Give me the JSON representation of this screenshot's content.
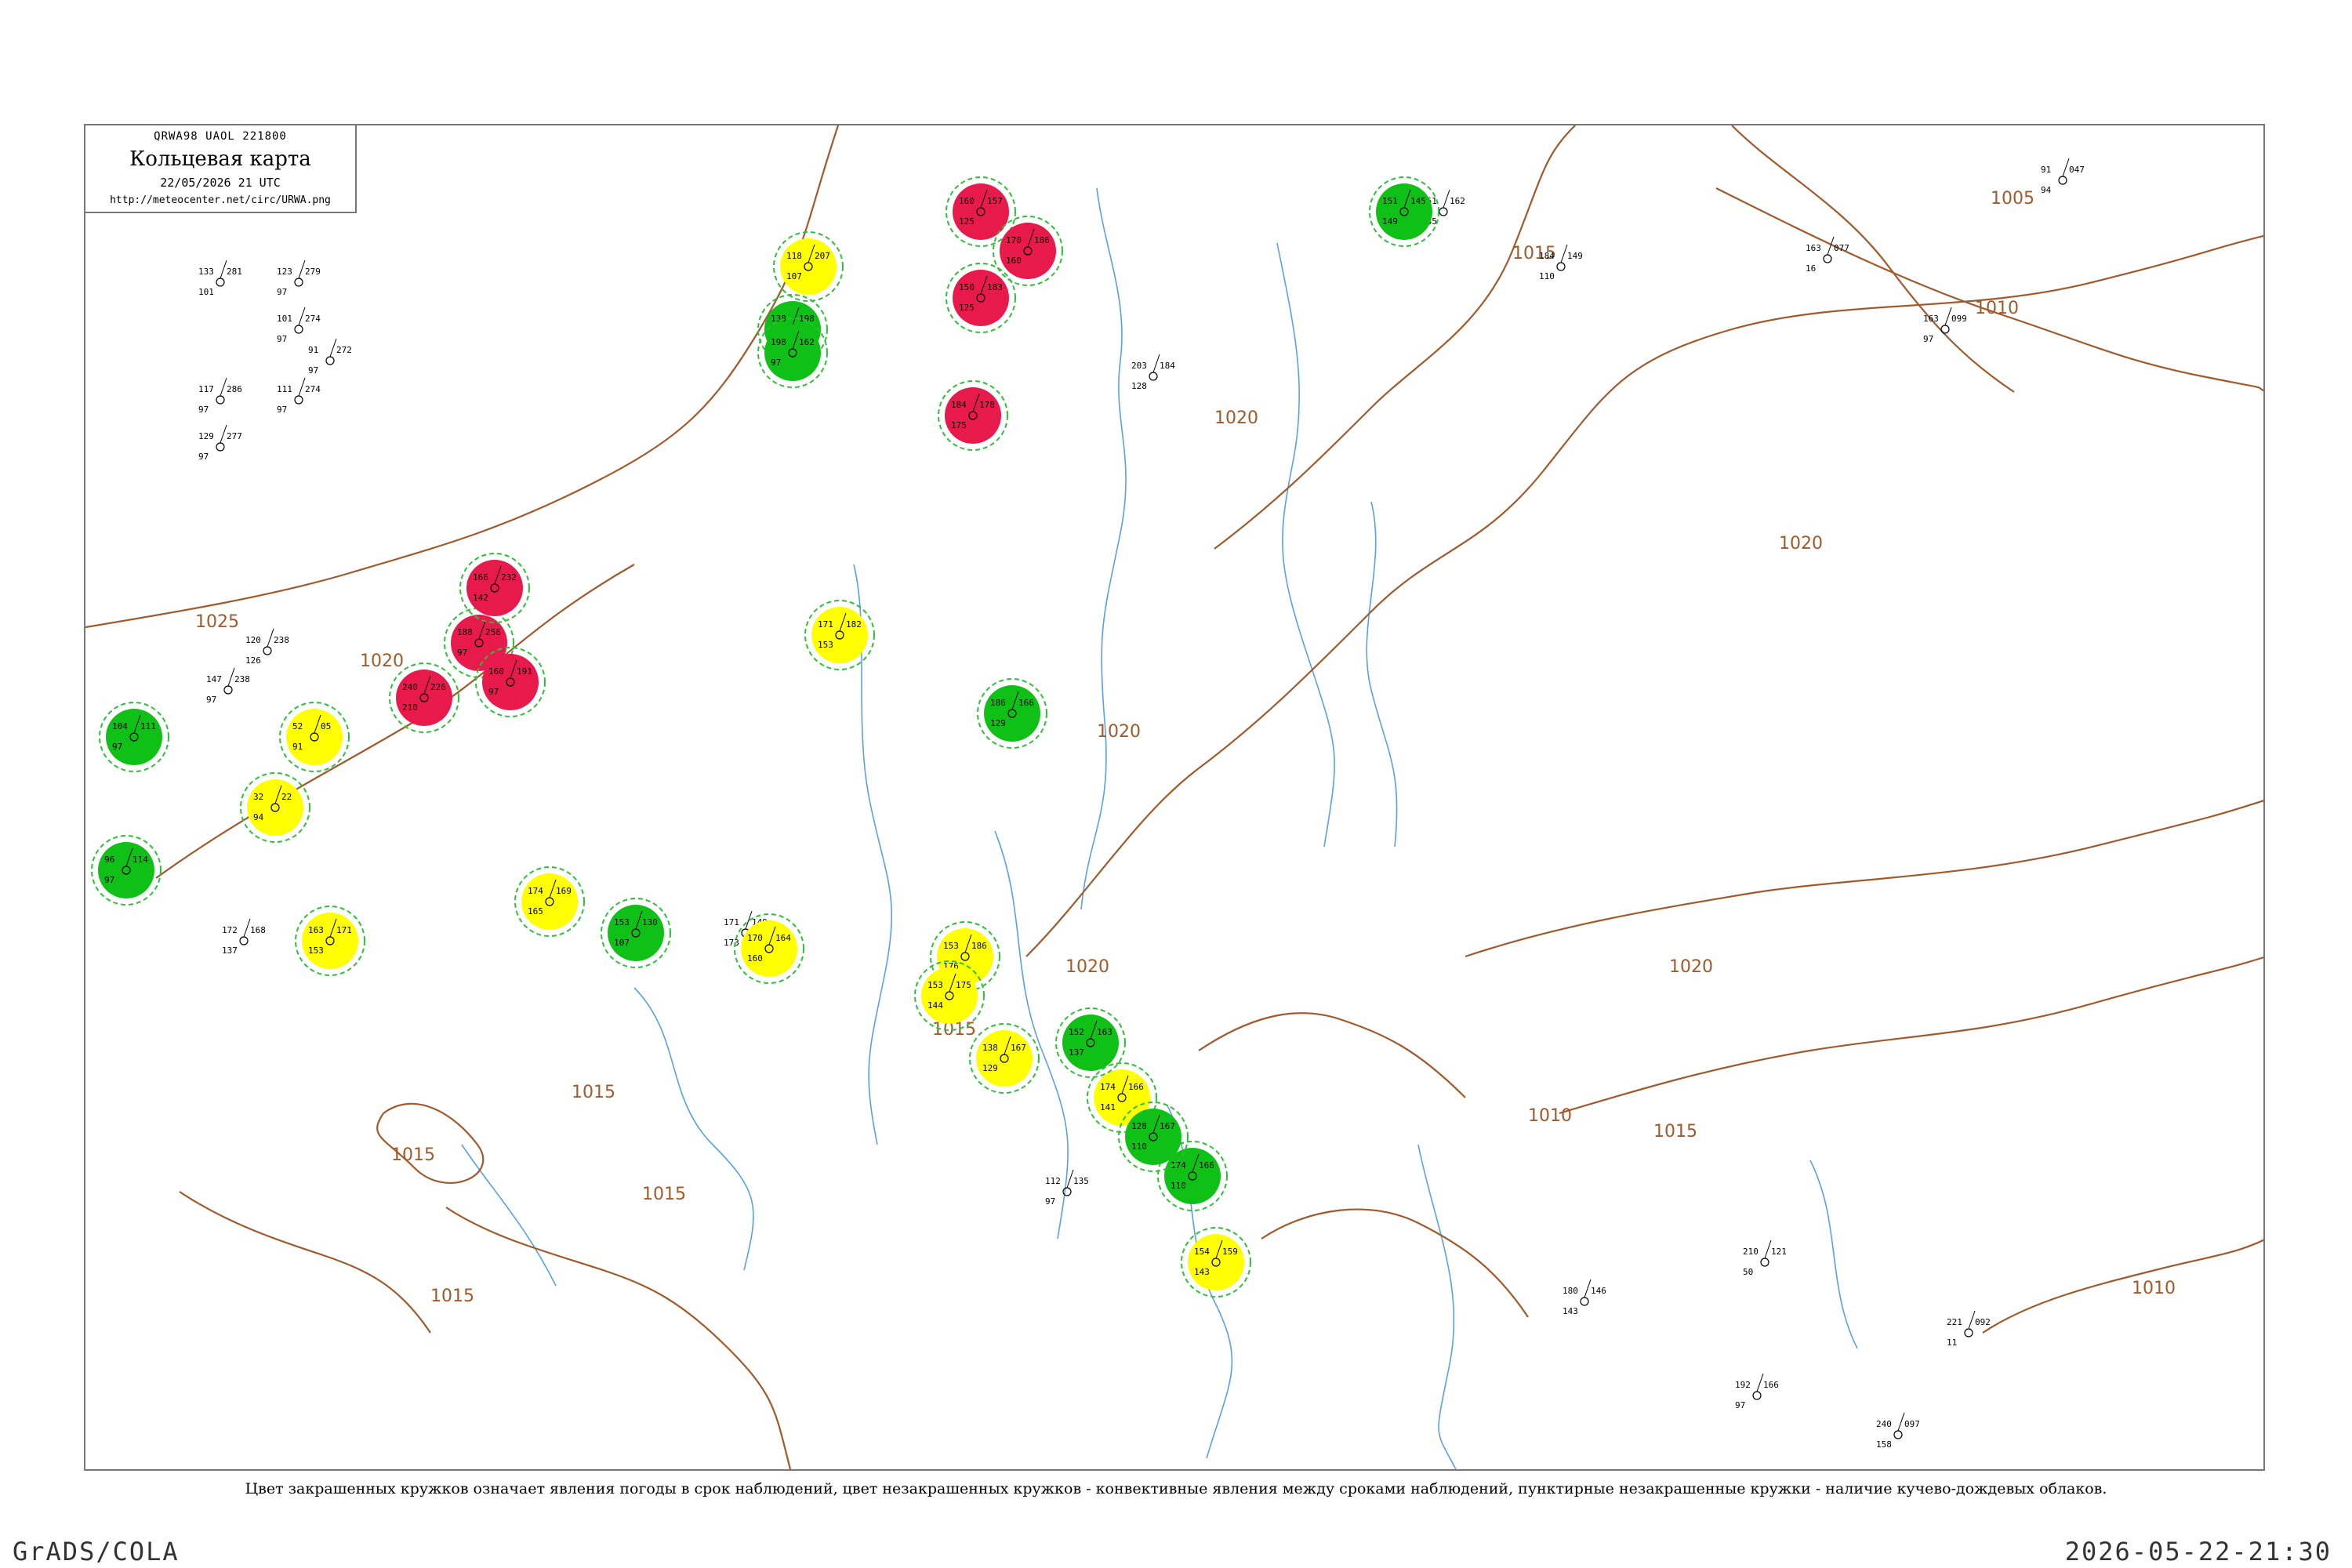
{
  "header": {
    "code": "QRWA98  UAOL  221800",
    "title": "Кольцевая карта",
    "datetime": "22/05/2026 21 UTC",
    "url": "http://meteocenter.net/circ/URWA.png"
  },
  "caption": "Цвет закрашенных кружков означает явления погоды в срок наблюдений, цвет незакрашенных кружков - конвективные явления между сроками наблюдений, пунктирные незакрашенные кружки - наличие кучево-дождевых облаков.",
  "footer": {
    "left": "GrADS/COLA",
    "right": "2026-05-22-21:30"
  },
  "colors": {
    "thunder": "#e8194b",
    "rain": "#0fc016",
    "fog": "#ffff00",
    "isobar": "#a05a2c",
    "river": "#5aa0e6",
    "cb_dashed": "#2fbf3a"
  },
  "isobar_labels": [
    "1025",
    "1020",
    "1015",
    "1015",
    "1015",
    "1015",
    "1015",
    "1020",
    "1020",
    "1020",
    "1015",
    "1010",
    "1005",
    "1010",
    "1020",
    "1020",
    "1015",
    "1010"
  ],
  "stations": [
    {
      "id": "s1",
      "pressure": "133",
      "temp": "281",
      "dew": "101",
      "marker": "none"
    },
    {
      "id": "s2",
      "pressure": "123",
      "temp": "279",
      "dew": "97",
      "marker": "none"
    },
    {
      "id": "s3",
      "pressure": "101",
      "temp": "274",
      "dew": "97",
      "marker": "none"
    },
    {
      "id": "s4",
      "pressure": "91",
      "temp": "272",
      "dew": "97",
      "marker": "none"
    },
    {
      "id": "s5",
      "pressure": "117",
      "temp": "286",
      "dew": "97",
      "marker": "none"
    },
    {
      "id": "s6",
      "pressure": "111",
      "temp": "274",
      "dew": "97",
      "marker": "none"
    },
    {
      "id": "s7",
      "pressure": "129",
      "temp": "277",
      "dew": "97",
      "marker": "none"
    },
    {
      "id": "s8",
      "pressure": "120",
      "temp": "238",
      "dew": "126",
      "marker": "none"
    },
    {
      "id": "s9",
      "pressure": "147",
      "temp": "238",
      "dew": "97",
      "marker": "none"
    },
    {
      "id": "s10",
      "pressure": "240",
      "temp": "226",
      "dew": "210",
      "marker": "thunder"
    },
    {
      "id": "s11",
      "pressure": "52",
      "temp": "05",
      "dew": "91",
      "marker": "fog"
    },
    {
      "id": "s12",
      "pressure": "32",
      "temp": "22",
      "dew": "94",
      "marker": "fog"
    },
    {
      "id": "s13",
      "pressure": "188",
      "temp": "256",
      "dew": "97",
      "marker": "thunder"
    },
    {
      "id": "s14",
      "pressure": "166",
      "temp": "232",
      "dew": "142",
      "marker": "thunder"
    },
    {
      "id": "s15",
      "pressure": "160",
      "temp": "191",
      "dew": "97",
      "marker": "thunder"
    },
    {
      "id": "s16",
      "pressure": "104",
      "temp": "111",
      "dew": "97",
      "marker": "rain"
    },
    {
      "id": "s17",
      "pressure": "96",
      "temp": "114",
      "dew": "97",
      "marker": "rain"
    },
    {
      "id": "s18",
      "pressure": "172",
      "temp": "168",
      "dew": "137",
      "marker": "none"
    },
    {
      "id": "s19",
      "pressure": "163",
      "temp": "171",
      "dew": "153",
      "marker": "fog"
    },
    {
      "id": "s20",
      "pressure": "174",
      "temp": "169",
      "dew": "165",
      "marker": "fog"
    },
    {
      "id": "s21",
      "pressure": "153",
      "temp": "130",
      "dew": "107",
      "marker": "rain"
    },
    {
      "id": "s22",
      "pressure": "118",
      "temp": "207",
      "dew": "107",
      "marker": "fog"
    },
    {
      "id": "s23",
      "pressure": "138",
      "temp": "198",
      "dew": "160",
      "marker": "rain"
    },
    {
      "id": "s24",
      "pressure": "198",
      "temp": "162",
      "dew": "97",
      "marker": "rain"
    },
    {
      "id": "s25",
      "pressure": "171",
      "temp": "182",
      "dew": "153",
      "marker": "fog"
    },
    {
      "id": "s26",
      "pressure": "160",
      "temp": "157",
      "dew": "125",
      "marker": "thunder"
    },
    {
      "id": "s27",
      "pressure": "150",
      "temp": "183",
      "dew": "125",
      "marker": "thunder"
    },
    {
      "id": "s28",
      "pressure": "170",
      "temp": "186",
      "dew": "160",
      "marker": "thunder"
    },
    {
      "id": "s29",
      "pressure": "184",
      "temp": "178",
      "dew": "175",
      "marker": "thunder"
    },
    {
      "id": "s30",
      "pressure": "171",
      "temp": "149",
      "dew": "173",
      "marker": "none"
    },
    {
      "id": "s31",
      "pressure": "170",
      "temp": "164",
      "dew": "160",
      "marker": "fog"
    },
    {
      "id": "s32",
      "pressure": "153",
      "temp": "186",
      "dew": "176",
      "marker": "fog"
    },
    {
      "id": "s33",
      "pressure": "153",
      "temp": "175",
      "dew": "144",
      "marker": "fog"
    },
    {
      "id": "s34",
      "pressure": "186",
      "temp": "166",
      "dew": "129",
      "marker": "rain"
    },
    {
      "id": "s35",
      "pressure": "138",
      "temp": "167",
      "dew": "129",
      "marker": "fog"
    },
    {
      "id": "s36",
      "pressure": "174",
      "temp": "166",
      "dew": "141",
      "marker": "fog"
    },
    {
      "id": "s37",
      "pressure": "154",
      "temp": "159",
      "dew": "143",
      "marker": "fog"
    },
    {
      "id": "s38",
      "pressure": "152",
      "temp": "163",
      "dew": "137",
      "marker": "rain"
    },
    {
      "id": "s39",
      "pressure": "174",
      "temp": "166",
      "dew": "110",
      "marker": "rain"
    },
    {
      "id": "s40",
      "pressure": "128",
      "temp": "167",
      "dew": "110",
      "marker": "rain"
    },
    {
      "id": "s41",
      "pressure": "203",
      "temp": "184",
      "dew": "128",
      "marker": "none"
    },
    {
      "id": "s42",
      "pressure": "151",
      "temp": "162",
      "dew": "145",
      "marker": "none"
    },
    {
      "id": "s43",
      "pressure": "151",
      "temp": "145",
      "dew": "149",
      "marker": "rain"
    },
    {
      "id": "s44",
      "pressure": "184",
      "temp": "149",
      "dew": "110",
      "marker": "none"
    },
    {
      "id": "s45",
      "pressure": "91",
      "temp": "047",
      "dew": "94",
      "marker": "none"
    },
    {
      "id": "s46",
      "pressure": "163",
      "temp": "077",
      "dew": "16",
      "marker": "none"
    },
    {
      "id": "s47",
      "pressure": "163",
      "temp": "099",
      "dew": "97",
      "marker": "none"
    },
    {
      "id": "s48",
      "pressure": "180",
      "temp": "146",
      "dew": "143",
      "marker": "none"
    },
    {
      "id": "s49",
      "pressure": "210",
      "temp": "121",
      "dew": "50",
      "marker": "none"
    },
    {
      "id": "s50",
      "pressure": "221",
      "temp": "092",
      "dew": "11",
      "marker": "none"
    },
    {
      "id": "s51",
      "pressure": "240",
      "temp": "097",
      "dew": "158",
      "marker": "none"
    },
    {
      "id": "s52",
      "pressure": "192",
      "temp": "166",
      "dew": "97",
      "marker": "none"
    },
    {
      "id": "s53",
      "pressure": "112",
      "temp": "135",
      "dew": "97",
      "marker": "none"
    }
  ]
}
